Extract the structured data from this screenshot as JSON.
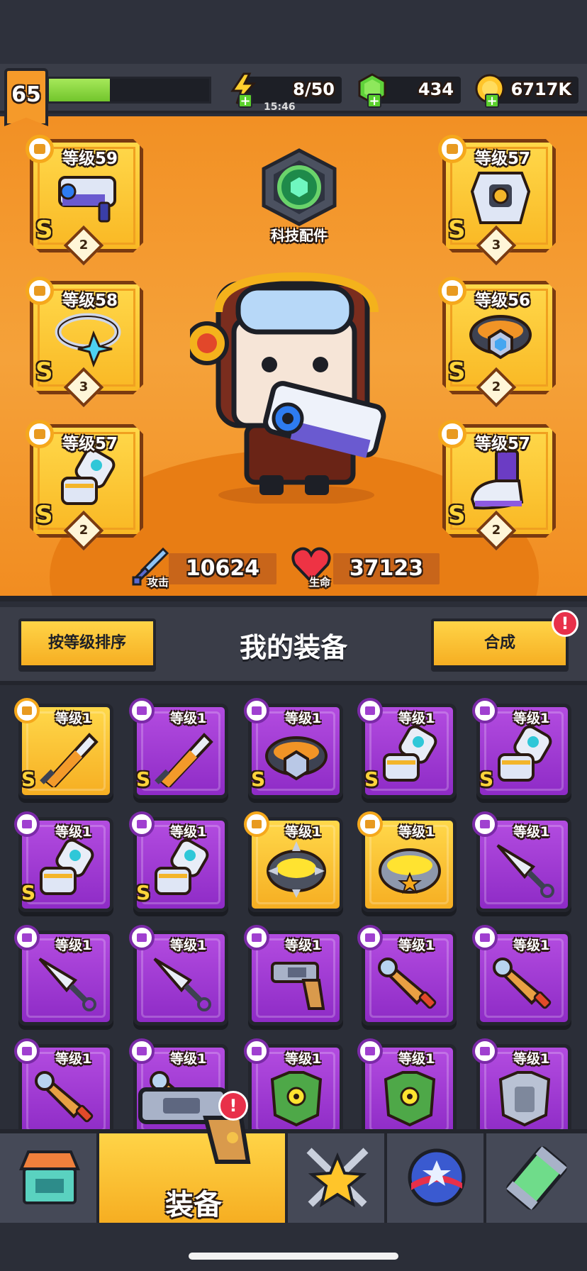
{
  "player": {
    "level": "65",
    "xp_fraction": 0.38
  },
  "resources": {
    "energy": {
      "value": "8/50",
      "timer": "15:46",
      "icon": "lightning-icon"
    },
    "gems": {
      "value": "434",
      "icon": "gem-icon"
    },
    "coins": {
      "value": "6717K",
      "icon": "coin-icon"
    }
  },
  "equipped": {
    "weapon": {
      "level": "等级59",
      "grade": "S",
      "stars": "2",
      "icon": "blaster-icon"
    },
    "armor": {
      "level": "等级57",
      "grade": "S",
      "stars": "3",
      "icon": "armor-icon"
    },
    "necklace": {
      "level": "等级58",
      "grade": "S",
      "stars": "3",
      "icon": "necklace-icon"
    },
    "belt": {
      "level": "等级56",
      "grade": "S",
      "stars": "2",
      "icon": "belt-icon"
    },
    "gloves": {
      "level": "等级57",
      "grade": "S",
      "stars": "2",
      "icon": "gauntlet-icon"
    },
    "boots": {
      "level": "等级57",
      "grade": "S",
      "stars": "2",
      "icon": "boots-icon"
    }
  },
  "tech": {
    "label": "科技配件",
    "icon": "tech-hexagon-icon"
  },
  "stats": {
    "attack": {
      "label": "攻击",
      "value": "10624",
      "icon": "sword-icon"
    },
    "hp": {
      "label": "生命",
      "value": "37123",
      "icon": "heart-icon"
    }
  },
  "section": {
    "sort_label": "按等级排序",
    "title": "我的装备",
    "merge_label": "合成",
    "merge_alert": "!"
  },
  "inventory": [
    {
      "level": "等级1",
      "grade": "S",
      "rarity": "gold",
      "icon": "sword-icon"
    },
    {
      "level": "等级1",
      "grade": "S",
      "rarity": "purple",
      "icon": "sword-icon"
    },
    {
      "level": "等级1",
      "grade": "S",
      "rarity": "purple",
      "icon": "belt-icon"
    },
    {
      "level": "等级1",
      "grade": "S",
      "rarity": "purple",
      "icon": "gauntlet-icon"
    },
    {
      "level": "等级1",
      "grade": "S",
      "rarity": "purple",
      "icon": "gauntlet-icon"
    },
    {
      "level": "等级1",
      "grade": "S",
      "rarity": "purple",
      "icon": "gauntlet-icon"
    },
    {
      "level": "等级1",
      "grade": "S",
      "rarity": "purple",
      "icon": "gauntlet-icon"
    },
    {
      "level": "等级1",
      "grade": "",
      "rarity": "gold",
      "icon": "spiked-ring-icon"
    },
    {
      "level": "等级1",
      "grade": "",
      "rarity": "gold",
      "icon": "star-belt-icon"
    },
    {
      "level": "等级1",
      "grade": "",
      "rarity": "purple",
      "icon": "kunai-icon"
    },
    {
      "level": "等级1",
      "grade": "",
      "rarity": "purple",
      "icon": "kunai-icon"
    },
    {
      "level": "等级1",
      "grade": "",
      "rarity": "purple",
      "icon": "kunai-icon"
    },
    {
      "level": "等级1",
      "grade": "",
      "rarity": "purple",
      "icon": "revolver-icon"
    },
    {
      "level": "等级1",
      "grade": "",
      "rarity": "purple",
      "icon": "megaphone-icon"
    },
    {
      "level": "等级1",
      "grade": "",
      "rarity": "purple",
      "icon": "megaphone-icon"
    },
    {
      "level": "等级1",
      "grade": "",
      "rarity": "purple",
      "icon": "megaphone-icon"
    },
    {
      "level": "等级1",
      "grade": "",
      "rarity": "purple",
      "icon": "megaphone-icon"
    },
    {
      "level": "等级1",
      "grade": "",
      "rarity": "purple",
      "icon": "green-armor-icon"
    },
    {
      "level": "等级1",
      "grade": "",
      "rarity": "purple",
      "icon": "green-armor-icon"
    },
    {
      "level": "等级1",
      "grade": "",
      "rarity": "purple",
      "icon": "steel-armor-icon"
    }
  ],
  "nav": {
    "shop": {
      "icon": "shop-icon"
    },
    "equipment": {
      "label": "装备",
      "icon": "revolver-icon",
      "alert": "!"
    },
    "talent": {
      "icon": "crossed-swords-star-icon"
    },
    "gacha": {
      "icon": "star-ball-icon"
    },
    "lab": {
      "icon": "dna-capsule-icon"
    }
  },
  "colors": {
    "hero_bg": "#f29024",
    "slot_gold": "#ffd84a",
    "item_purple": "#a53dd6",
    "panel_dark": "#3a3d48",
    "xp_green": "#8fd843",
    "alert_red": "#e8304a"
  }
}
